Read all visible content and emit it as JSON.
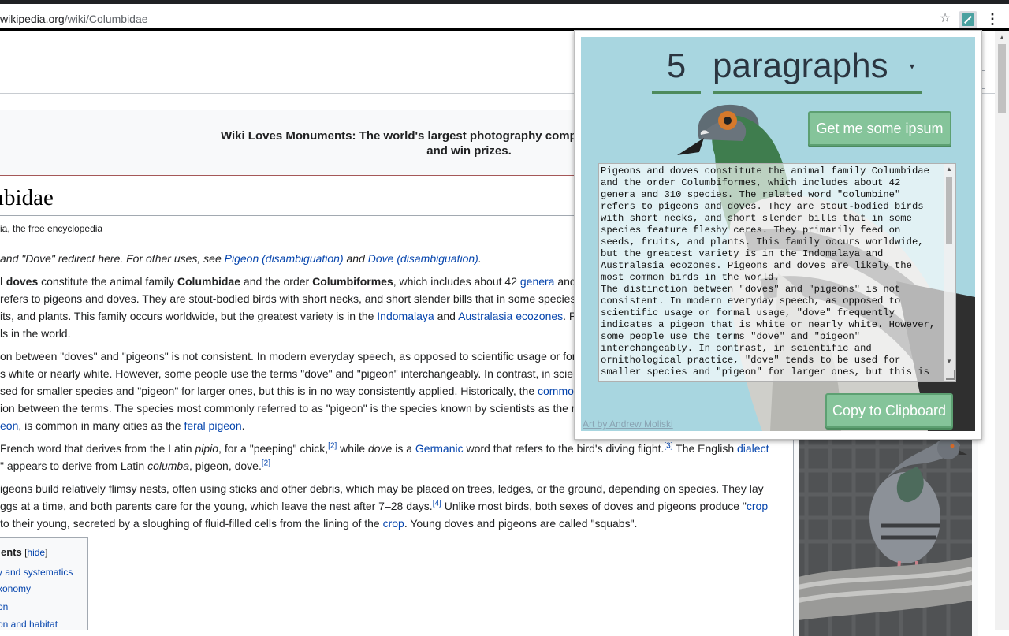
{
  "browser": {
    "url_domain": "wikipedia.org",
    "url_path": "/wiki/Columbidae",
    "star_icon": "star-icon",
    "extension_icon": "pigeon-ipsum-icon",
    "menu_icon": "kebab-icon"
  },
  "wiki": {
    "banner_line1": "Wiki Loves Monuments: The world's largest photography competition is now open! Phot",
    "banner_line2": "and win prizes.",
    "title": "ıbidae",
    "tagline": "ia, the free encyclopedia",
    "hatnote": {
      "pre": "and \"Dove\" redirect here. For other uses, see ",
      "link1": "Pigeon (disambiguation)",
      "mid": " and ",
      "link2": "Dove (disambiguation)",
      "post": "."
    },
    "p1": {
      "a_bold": "l doves",
      "b": " constitute the animal family ",
      "c_bold": "Columbidae",
      "d": " and the order ",
      "e_bold": "Columbiformes",
      "f": ", which includes about 42 ",
      "g_link": "genera",
      "h": " and",
      "l2": "refers to pigeons and doves. They are stout-bodied birds with short necks, and short slender bills that in some species",
      "l3a": "its, and plants. This family occurs worldwide, but the greatest variety is in the ",
      "l3b_link": "Indomalaya",
      "l3c": " and ",
      "l3d_link": "Australasia ecozones",
      "l3e": ". P",
      "l4": "ls in the world."
    },
    "p2": {
      "l1": "on between \"doves\" and \"pigeons\" is not consistent. In modern everyday speech, as opposed to scientific usage or forr",
      "l2": "s white or nearly white. However, some people use the terms \"dove\" and \"pigeon\" interchangeably. In contrast, in scier",
      "l3a": "sed for smaller species and \"pigeon\" for larger ones, but this is in no way consistently applied. Historically, the ",
      "l3b_link": "commo",
      "l4": "ion between the terms. The species most commonly referred to as \"pigeon\" is the species known by scientists as the r",
      "l5a_link": "eon",
      "l5b": ", is common in many cities as the ",
      "l5c_link": "feral pigeon",
      "l5d": "."
    },
    "p3": {
      "l1a": "French word that derives from the Latin ",
      "l1b_i": "pipio",
      "l1c": ", for a \"peeping\" chick,",
      "ref2": "[2]",
      "l1d": " while ",
      "l1e_i": "dove",
      "l1f": " is a ",
      "l1g_link": "Germanic",
      "l1h": " word that refers to the bird's diving flight.",
      "ref3": "[3]",
      "l1i": " The English ",
      "l1j_link": "dialect",
      "l2a": "\" appears to derive from Latin ",
      "l2b_i": "columba",
      "l2c": ", pigeon, dove.",
      "ref2b": "[2]"
    },
    "p4": {
      "l1": "igeons build relatively flimsy nests, often using sticks and other debris, which may be placed on trees, ledges, or the ground, depending on species. They lay",
      "l2a": "ggs at a time, and both parents care for the young, which leave the nest after 7–28 days.",
      "ref4": "[4]",
      "l2b": " Unlike most birds, both sexes of doves and pigeons produce \"",
      "l2c_link": "crop",
      "l3a": " to their young, secreted by a sloughing of fluid-filled cells from the lining of the ",
      "l3b_link": "crop",
      "l3c": ". Young doves and pigeons are called \"squabs\"."
    },
    "toc": {
      "title": "ents",
      "hide_open": " [",
      "hide": "hide",
      "hide_close": "]",
      "items": [
        "y and systematics",
        "xonomy",
        "on",
        "on and habitat"
      ]
    }
  },
  "popup": {
    "count": "5",
    "unit": "paragraphs",
    "get_button": "Get me some ipsum",
    "copy_button": "Copy to Clipboard",
    "credit": "Art by Andrew Moliski",
    "ipsum_text": "Pigeons and doves constitute the animal family Columbidae\nand the order Columbiformes, which includes about 42\ngenera and 310 species. The related word \"columbine\"\nrefers to pigeons and doves. They are stout-bodied birds\nwith short necks, and short slender bills that in some\nspecies feature fleshy ceres. They primarily feed on\nseeds, fruits, and plants. This family occurs worldwide,\nbut the greatest variety is in the Indomalaya and\nAustralasia ecozones. Pigeons and doves are likely the\nmost common birds in the world.\nThe distinction between \"doves\" and \"pigeons\" is not\nconsistent. In modern everyday speech, as opposed to\nscientific usage or formal usage, \"dove\" frequently\nindicates a pigeon that is white or nearly white. However,\nsome people use the terms \"dove\" and \"pigeon\"\ninterchangeably. In contrast, in scientific and\nornithological practice, \"dove\" tends to be used for\nsmaller species and \"pigeon\" for larger ones, but this is\nin no way consistently applied."
  }
}
